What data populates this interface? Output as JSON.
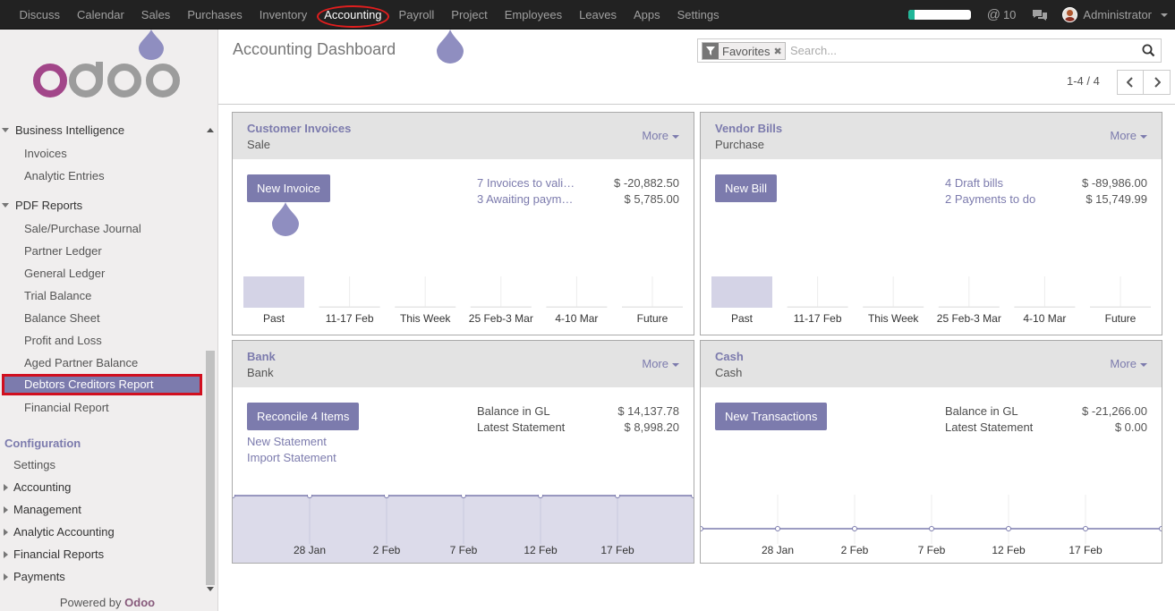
{
  "topnav": {
    "items": [
      "Discuss",
      "Calendar",
      "Sales",
      "Purchases",
      "Inventory",
      "Accounting",
      "Payroll",
      "Project",
      "Employees",
      "Leaves",
      "Apps",
      "Settings"
    ],
    "active": "Accounting"
  },
  "topright": {
    "progress_fraction": 0.1,
    "mentions": "10",
    "user": "Administrator"
  },
  "sidebar": {
    "bi": "Business Intelligence",
    "bi_items": [
      "Invoices",
      "Analytic Entries"
    ],
    "pdf": "PDF Reports",
    "pdf_items": [
      "Sale/Purchase Journal",
      "Partner Ledger",
      "General Ledger",
      "Trial Balance",
      "Balance Sheet",
      "Profit and Loss",
      "Aged Partner Balance",
      "Debtors Creditors Report",
      "Financial Report"
    ],
    "active_item": "Debtors Creditors Report",
    "config": "Configuration",
    "settings": "Settings",
    "config_items": [
      "Accounting",
      "Management",
      "Analytic Accounting",
      "Financial Reports",
      "Payments"
    ],
    "powered_prefix": "Powered by ",
    "powered_brand": "Odoo"
  },
  "control_panel": {
    "title": "Accounting Dashboard",
    "facet": "Favorites",
    "search_placeholder": "Search...",
    "pager": "1-4 / 4"
  },
  "cards": {
    "customer": {
      "name": "Customer Invoices",
      "type": "Sale",
      "more": "More",
      "button": "New Invoice",
      "stats": [
        {
          "label": "7 Invoices to validate",
          "display": "7 Invoices to vali…",
          "amount": "$ -20,882.50"
        },
        {
          "label": "3 Awaiting payments",
          "display": "3 Awaiting paym…",
          "amount": "$ 5,785.00"
        }
      ]
    },
    "vendor": {
      "name": "Vendor Bills",
      "type": "Purchase",
      "more": "More",
      "button": "New Bill",
      "stats": [
        {
          "label": "4 Draft bills",
          "display": "4 Draft bills",
          "amount": "$ -89,986.00"
        },
        {
          "label": "2 Payments to do",
          "display": "2 Payments to do",
          "amount": "$ 15,749.99"
        }
      ]
    },
    "bank": {
      "name": "Bank",
      "type": "Bank",
      "more": "More",
      "button": "Reconcile 4 Items",
      "stats": [
        {
          "label": "Balance in GL",
          "display": "Balance in GL",
          "amount": "$ 14,137.78"
        },
        {
          "label": "Latest Statement",
          "display": "Latest Statement",
          "amount": "$ 8,998.20"
        }
      ],
      "links": [
        "New Statement",
        "Import Statement"
      ]
    },
    "cash": {
      "name": "Cash",
      "type": "Cash",
      "more": "More",
      "button": "New Transactions",
      "stats": [
        {
          "label": "Balance in GL",
          "display": "Balance in GL",
          "amount": "$ -21,266.00"
        },
        {
          "label": "Latest Statement",
          "display": "Latest Statement",
          "amount": "$ 0.00"
        }
      ]
    }
  },
  "chart_data": [
    {
      "type": "bar",
      "categories": [
        "Past",
        "11-17 Feb",
        "This Week",
        "25 Feb-3 Mar",
        "4-10 Mar",
        "Future"
      ],
      "values": [
        1,
        0,
        0,
        0,
        0,
        0
      ]
    },
    {
      "type": "bar",
      "categories": [
        "Past",
        "11-17 Feb",
        "This Week",
        "25 Feb-3 Mar",
        "4-10 Mar",
        "Future"
      ],
      "values": [
        1,
        0,
        0,
        0,
        0,
        0
      ]
    },
    {
      "type": "area",
      "categories": [
        "28 Jan",
        "2 Feb",
        "7 Feb",
        "12 Feb",
        "17 Feb"
      ],
      "fill": "#dcdbea"
    },
    {
      "type": "line",
      "categories": [
        "28 Jan",
        "2 Feb",
        "7 Feb",
        "12 Feb",
        "17 Feb"
      ]
    }
  ]
}
